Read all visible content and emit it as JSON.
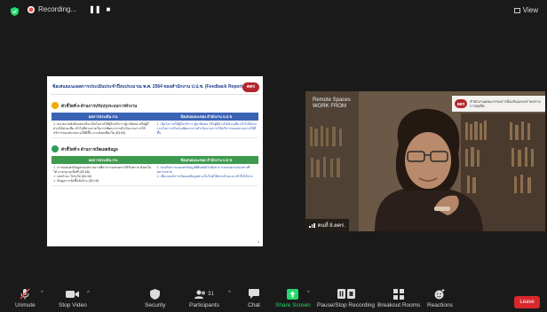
{
  "topbar": {
    "recording_label": "Recording...",
    "pause_glyph": "❚❚",
    "stop_glyph": "■",
    "view_label": "View"
  },
  "slide": {
    "title": "ข้อเสนอแนะผลการประเมินประจำปีงบประมาณ พ.ศ. 2564 ของสำนักงาน ป.ป.ช. (Feedback Report) (ต่อ)",
    "logo_text": "ตคร",
    "page_number": "4",
    "sections": [
      {
        "topic": "ตัวชี้วัดที่ 8 ด้านการปรับปรุงระบบการทำงาน",
        "headers": [
          "ผลการประเมิน ITA",
          "ข้อเสนอแนะของ สำนักงาน ป.ป.ช."
        ],
        "rows": [
          {
            "result": "1. หน่วยงานยังต้องส่งเสริม เปิดโอกาสให้ผู้รับบริการ ผู้มาติดต่อ หรือผู้มีส่วนได้ส่วนเสีย เข้าไปมีส่วนร่วมในการพัฒนาการดำเนินงาน/การให้บริการของหน่วยงานให้ดีขึ้น มากน้อยเพียงใด (83.69)",
            "suggestion": "1. เปิดโอกาสให้ผู้รับบริการ ผู้มาติดต่อ หรือผู้มีส่วนได้ส่วนเสีย เข้าไปมีส่วนร่วมในการปรับปรุงพัฒนาการดำเนินงาน/การให้บริการของหน่วยงานให้ดีขึ้น"
          }
        ]
      },
      {
        "topic": "ตัวชี้วัดที่ 9 ด้านการเปิดเผยข้อมูล",
        "headers": [
          "ผลการประเมิน ITA",
          "ข้อเสนอแนะของ สำนักงาน ป.ป.ช."
        ],
        "rows": [
          {
            "result": "1. การเผยแพร่ข้อมูลของหน่วยงานที่สาธารณชนควรได้รับทราบ ยังคงไม่ได้ มาตรฐานเต็มที่ (83.66)\n➢ เจตจำนง โปร่งใส (84.16)\n➢ ข้อมูลการจัดซื้อจัดจ้าง (83.16)",
            "suggestion": "1. ส่งเสริมการเผยแพร่ข้อมูลที่ทันสมัยไปยังสาธารณชนผ่านช่องทางที่หลากหลาย\n2. เพิ่มเกณฑ์การเปิดเผยข้อมูลทางเว็บไซต์ให้ครบถ้วนและเข้าถึงได้ง่าย"
          }
        ]
      }
    ]
  },
  "video": {
    "remote_line1": "Remote Spaces",
    "remote_line2": "WORK FROM",
    "banner_logo": "ตคร",
    "banner_text": "สำนักงานคณะกรรมการป้องกันและปราบปรามการทุจริต",
    "participant_name": "คนที่ 8.ตคร."
  },
  "toolbar": {
    "unmute": "Unmute",
    "stop_video": "Stop Video",
    "security": "Security",
    "participants": "Participants",
    "participants_count": "31",
    "chat": "Chat",
    "share_screen": "Share Screen",
    "pause_stop_recording": "Pause/Stop Recording",
    "breakout_rooms": "Breakout Rooms",
    "reactions": "Reactions",
    "leave": "Leave"
  },
  "colors": {
    "share_green": "#23d96e",
    "leave_red": "#d8282d",
    "recording_red": "#e54b4b"
  }
}
